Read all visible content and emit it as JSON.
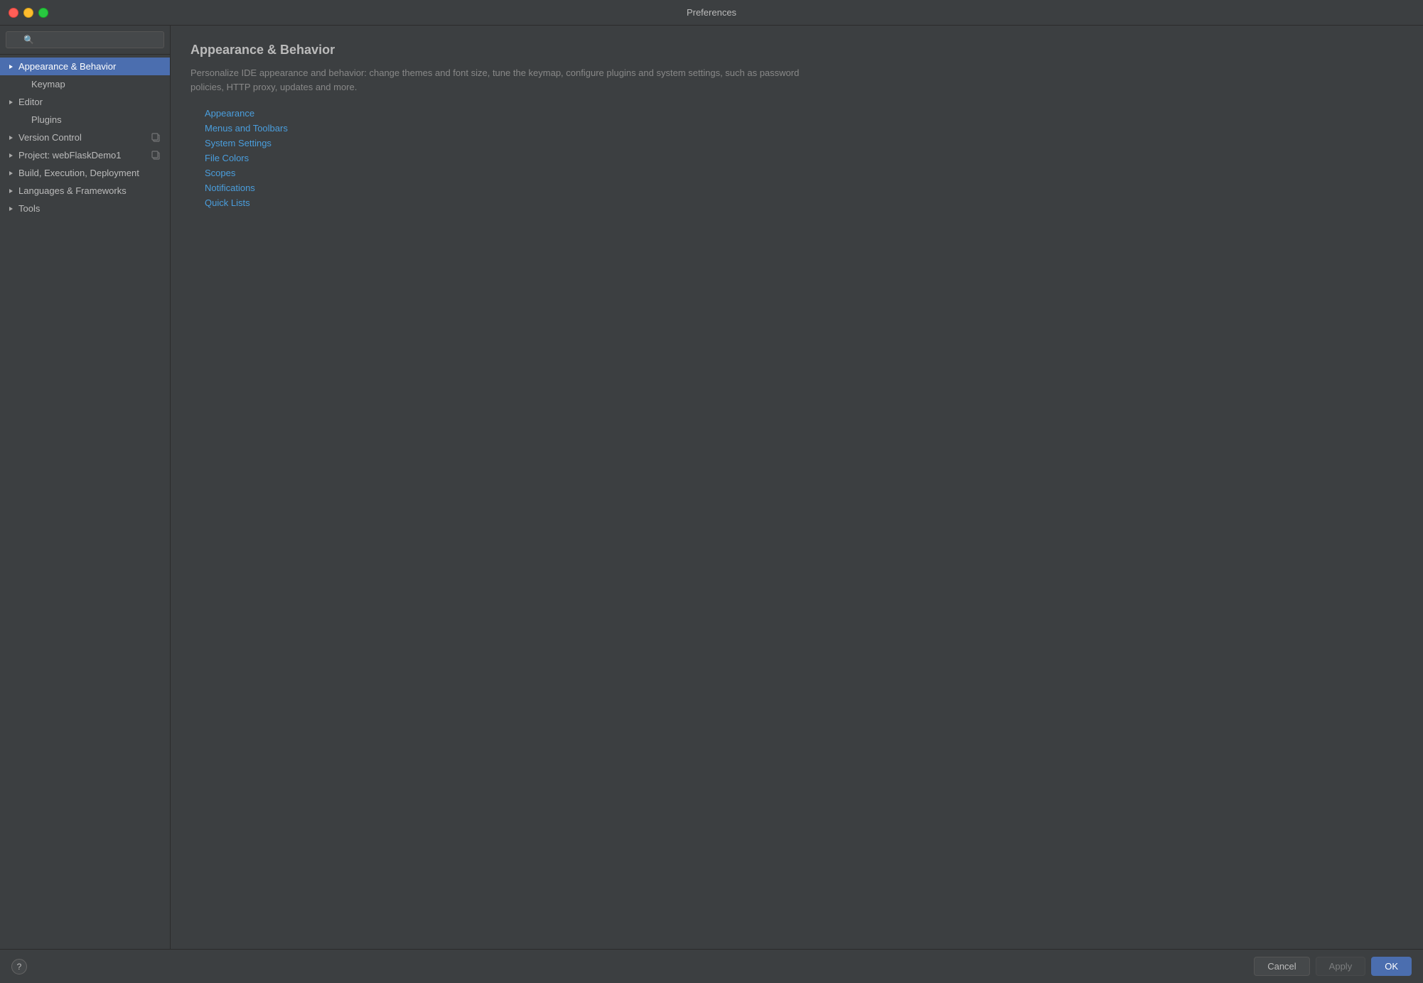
{
  "window": {
    "title": "Preferences"
  },
  "traffic_lights": {
    "close_label": "close",
    "minimize_label": "minimize",
    "maximize_label": "maximize"
  },
  "sidebar": {
    "search_placeholder": "🔍",
    "items": [
      {
        "id": "appearance-behavior",
        "label": "Appearance & Behavior",
        "has_chevron": true,
        "active": true,
        "indent": false,
        "has_copy": false
      },
      {
        "id": "keymap",
        "label": "Keymap",
        "has_chevron": false,
        "active": false,
        "indent": true,
        "has_copy": false
      },
      {
        "id": "editor",
        "label": "Editor",
        "has_chevron": true,
        "active": false,
        "indent": false,
        "has_copy": false
      },
      {
        "id": "plugins",
        "label": "Plugins",
        "has_chevron": false,
        "active": false,
        "indent": true,
        "has_copy": false
      },
      {
        "id": "version-control",
        "label": "Version Control",
        "has_chevron": true,
        "active": false,
        "indent": false,
        "has_copy": true
      },
      {
        "id": "project",
        "label": "Project: webFlaskDemo1",
        "has_chevron": true,
        "active": false,
        "indent": false,
        "has_copy": true
      },
      {
        "id": "build-execution",
        "label": "Build, Execution, Deployment",
        "has_chevron": true,
        "active": false,
        "indent": false,
        "has_copy": false
      },
      {
        "id": "languages-frameworks",
        "label": "Languages & Frameworks",
        "has_chevron": true,
        "active": false,
        "indent": false,
        "has_copy": false
      },
      {
        "id": "tools",
        "label": "Tools",
        "has_chevron": true,
        "active": false,
        "indent": false,
        "has_copy": false
      }
    ]
  },
  "content": {
    "title": "Appearance & Behavior",
    "description": "Personalize IDE appearance and behavior: change themes and font size, tune the keymap, configure plugins and system settings, such as password policies, HTTP proxy, updates and more.",
    "links": [
      {
        "id": "appearance",
        "label": "Appearance"
      },
      {
        "id": "menus-toolbars",
        "label": "Menus and Toolbars"
      },
      {
        "id": "system-settings",
        "label": "System Settings"
      },
      {
        "id": "file-colors",
        "label": "File Colors"
      },
      {
        "id": "scopes",
        "label": "Scopes"
      },
      {
        "id": "notifications",
        "label": "Notifications"
      },
      {
        "id": "quick-lists",
        "label": "Quick Lists"
      }
    ]
  },
  "bottom_bar": {
    "help_label": "?",
    "cancel_label": "Cancel",
    "apply_label": "Apply",
    "ok_label": "OK"
  }
}
